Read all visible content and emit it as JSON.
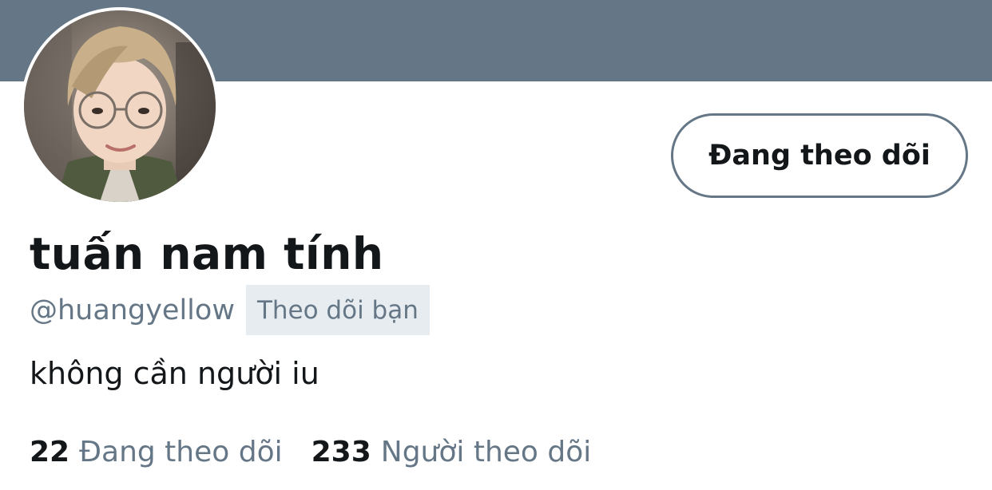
{
  "profile": {
    "display_name": "tuấn nam tính",
    "handle": "@huangyellow",
    "follows_you_badge": "Theo dõi bạn",
    "bio": "không cần người iu",
    "follow_button_label": "Đang theo dõi"
  },
  "stats": {
    "following_count": "22",
    "following_label": "Đang theo dõi",
    "followers_count": "233",
    "followers_label": "Người theo dõi"
  },
  "colors": {
    "banner": "#657786",
    "primary_text": "#14171a",
    "secondary_text": "#657786",
    "badge_background": "#e6ecf0"
  }
}
